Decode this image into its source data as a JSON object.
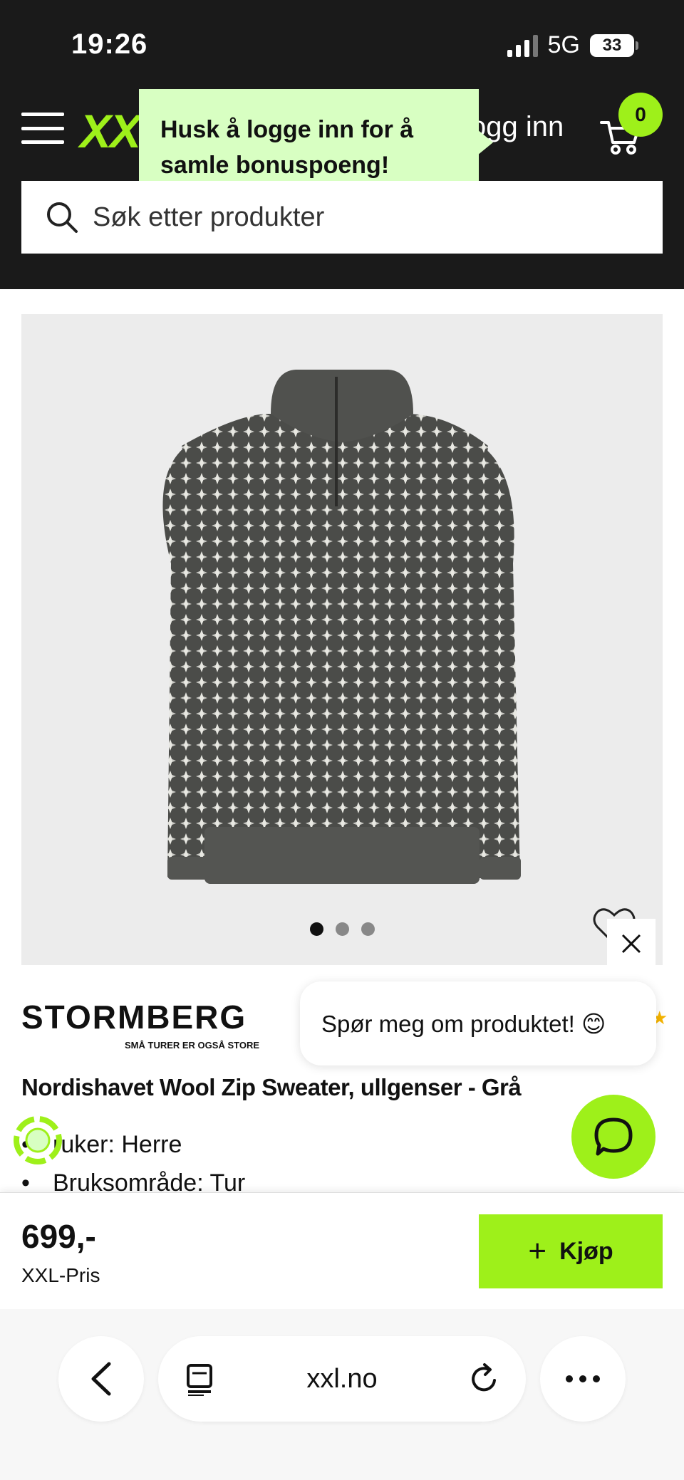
{
  "status_bar": {
    "time": "19:26",
    "network": "5G",
    "battery": "33"
  },
  "header": {
    "logo": "XXL",
    "login_label": "ogg inn",
    "cart_count": "0",
    "tooltip": "Husk å logge inn for å samle bonuspoeng!",
    "search_placeholder": "Søk etter produkter"
  },
  "gallery": {
    "image_count": 3,
    "active_index": 0
  },
  "brand": {
    "name": "STORMBERG",
    "tagline": "SMÅ TURER ER OGSÅ STORE"
  },
  "chat": {
    "prompt": "Spør meg om produktet! 😊"
  },
  "product": {
    "title": "Nordishavet Wool Zip Sweater, ullgenser - Grå",
    "properties": [
      "ruker: Herre",
      "Bruksområde: Tur"
    ]
  },
  "buy_bar": {
    "price": "699,-",
    "price_label": "XXL-Pris",
    "buy_label": "Kjøp"
  },
  "browser": {
    "url": "xxl.no"
  },
  "colors": {
    "brand_green": "#9ef01a",
    "header_bg": "#1a1a1a",
    "tooltip_bg": "#d8ffc2"
  }
}
